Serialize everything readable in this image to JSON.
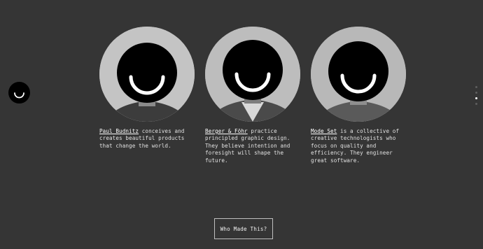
{
  "logo": {
    "icon": "smile-icon"
  },
  "people": [
    {
      "link": "Paul Budnitz",
      "text": " conceives and creates beautiful products that change the world.",
      "image": "portrait-paul-budnitz"
    },
    {
      "link": "Berger & Föhr",
      "text": " practice principled graphic design. They believe intention and foresight will shape the future.",
      "image": "portrait-berger-fohr"
    },
    {
      "link": "Mode Set",
      "text": " is a collective of creative technologists who focus on quality and efficiency. They engineer great software.",
      "image": "portrait-mode-set"
    }
  ],
  "pagination": {
    "count": 4,
    "active_index": 2
  },
  "cta": {
    "label": "Who Made This?"
  },
  "colors": {
    "background": "#353535",
    "text": "#e2e2e2",
    "accent": "#ffffff"
  }
}
